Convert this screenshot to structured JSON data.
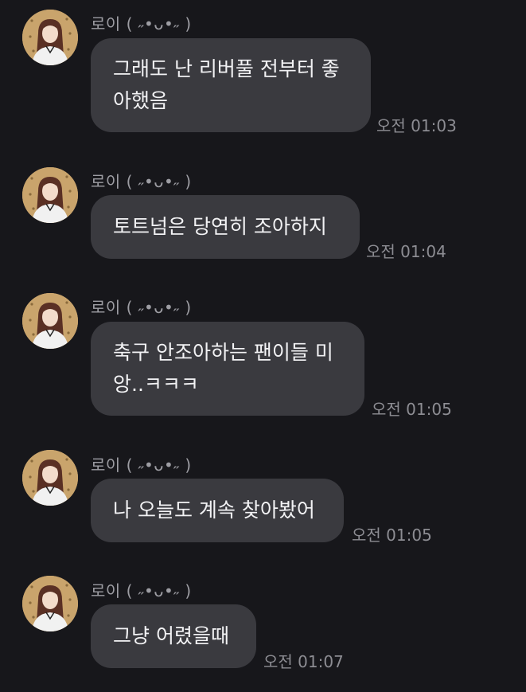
{
  "messages": [
    {
      "sender": "로이 ( ˶•ᴗ•˶ )",
      "text": "그래도 난 리버풀 전부터 좋\n아했음",
      "time": "오전 01:03"
    },
    {
      "sender": "로이 ( ˶•ᴗ•˶ )",
      "text": "토트넘은 당연히 조아하지",
      "time": "오전 01:04"
    },
    {
      "sender": "로이 ( ˶•ᴗ•˶ )",
      "text": "축구 안조아하는 팬이들 미\n앙..ㅋㅋㅋ",
      "time": "오전 01:05"
    },
    {
      "sender": "로이 ( ˶•ᴗ•˶ )",
      "text": "나 오늘도 계속 찾아봤어",
      "time": "오전 01:05"
    },
    {
      "sender": "로이 ( ˶•ᴗ•˶ )",
      "text": "그냥 어렸을때",
      "time": "오전 01:07"
    }
  ],
  "colors": {
    "background": "#17171b",
    "bubble": "#3a3a3f",
    "text": "#f2f2f4",
    "meta": "#8d8d93"
  },
  "icons": {
    "avatar": "profile-photo"
  }
}
